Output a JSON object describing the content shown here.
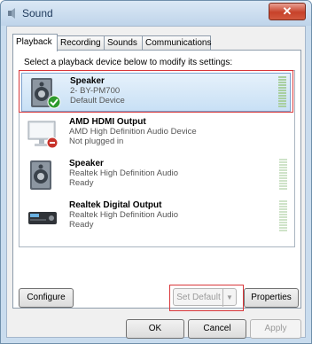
{
  "window": {
    "title": "Sound",
    "close_glyph": "✕"
  },
  "tabs": [
    {
      "label": "Playback"
    },
    {
      "label": "Recording"
    },
    {
      "label": "Sounds"
    },
    {
      "label": "Communications"
    }
  ],
  "instruction": "Select a playback device below to modify its settings:",
  "devices": [
    {
      "name": "Speaker",
      "line1": "2- BY-PM700",
      "line2": "Default Device",
      "icon": "speaker-icon",
      "status_icon": "check-badge-icon",
      "selected": true
    },
    {
      "name": "AMD HDMI Output",
      "line1": "AMD High Definition Audio Device",
      "line2": "Not plugged in",
      "icon": "monitor-icon",
      "status_icon": "unplugged-badge-icon",
      "selected": false
    },
    {
      "name": "Speaker",
      "line1": "Realtek High Definition Audio",
      "line2": "Ready",
      "icon": "speaker-icon",
      "selected": false
    },
    {
      "name": "Realtek Digital Output",
      "line1": "Realtek High Definition Audio",
      "line2": "Ready",
      "icon": "digital-receiver-icon",
      "selected": false
    }
  ],
  "panel_buttons": {
    "configure": "Configure",
    "set_default": "Set Default",
    "set_default_arrow": "▼",
    "properties": "Properties"
  },
  "dialog_buttons": {
    "ok": "OK",
    "cancel": "Cancel",
    "apply": "Apply"
  },
  "colors": {
    "highlight": "#d9373a",
    "selection": "#c8e0f5",
    "window_frame": "#c9dcee"
  }
}
